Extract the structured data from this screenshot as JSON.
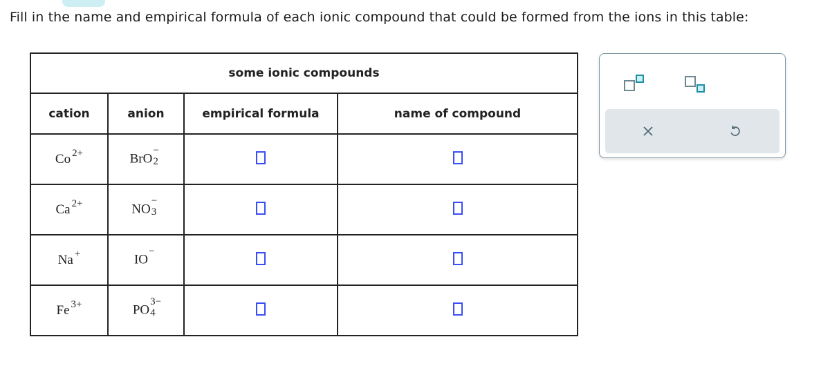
{
  "prompt": "Fill in the name and empirical formula of each ionic compound that could be formed from the ions in this table:",
  "table": {
    "title": "some ionic compounds",
    "headers": [
      "cation",
      "anion",
      "empirical formula",
      "name of compound"
    ],
    "rows": [
      {
        "cation": {
          "symbol": "Co",
          "charge": "2+"
        },
        "anion": {
          "symbol": "BrO",
          "subscript": "2",
          "charge": "−"
        },
        "empirical_formula": "",
        "name": ""
      },
      {
        "cation": {
          "symbol": "Ca",
          "charge": "2+"
        },
        "anion": {
          "symbol": "NO",
          "subscript": "3",
          "charge": "−"
        },
        "empirical_formula": "",
        "name": ""
      },
      {
        "cation": {
          "symbol": "Na",
          "charge": "+"
        },
        "anion": {
          "symbol": "IO",
          "subscript": "",
          "charge": "−"
        },
        "empirical_formula": "",
        "name": ""
      },
      {
        "cation": {
          "symbol": "Fe",
          "charge": "3+"
        },
        "anion": {
          "symbol": "PO",
          "subscript": "4",
          "charge": "3−"
        },
        "empirical_formula": "",
        "name": ""
      }
    ]
  },
  "toolbox": {
    "tools": [
      "superscript-tool",
      "subscript-tool"
    ],
    "actions": {
      "clear": "×",
      "undo": "↺"
    },
    "colors": {
      "accent": "#1a8fa7",
      "accent_fill": "#cdeef3",
      "border": "#6f8791",
      "input_border": "#3a4ef5"
    }
  }
}
